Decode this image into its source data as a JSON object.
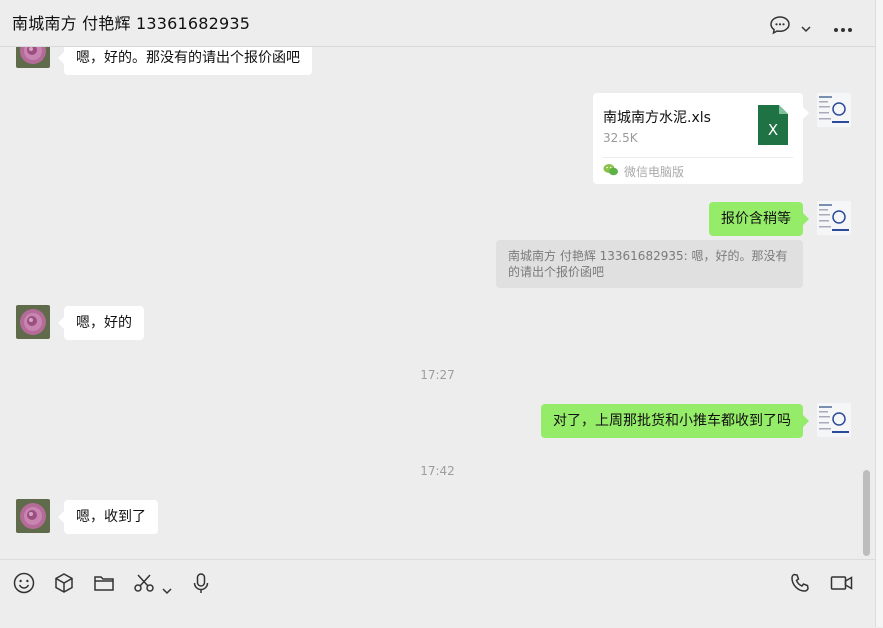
{
  "header": {
    "title": "南城南方 付艳辉 13361682935",
    "icons": [
      "chat-bubble-icon",
      "chevron-down-icon",
      "more-icon"
    ]
  },
  "messages": {
    "m1": "嗯，好的。那没有的请出个报价函吧",
    "file": {
      "name": "南城南方水泥.xls",
      "size": "32.5K",
      "source": "微信电脑版"
    },
    "m2": "报价含稍等",
    "quote": "南城南方 付艳辉 13361682935: 嗯，好的。那没有的请出个报价函吧",
    "m3": "嗯，好的",
    "time1": "17:27",
    "m4": "对了，上周那批货和小推车都收到了吗",
    "time2": "17:42",
    "m5": "嗯，收到了"
  },
  "toolbar": {
    "icons": [
      "emoji-icon",
      "box-icon",
      "folder-icon",
      "scissors-icon",
      "chevron-down-icon",
      "microphone-icon",
      "phone-icon",
      "video-icon"
    ]
  },
  "colors": {
    "background": "#ededed",
    "outgoing_bubble": "#95ec69",
    "incoming_bubble": "#ffffff",
    "excel_green": "#1f7244"
  }
}
